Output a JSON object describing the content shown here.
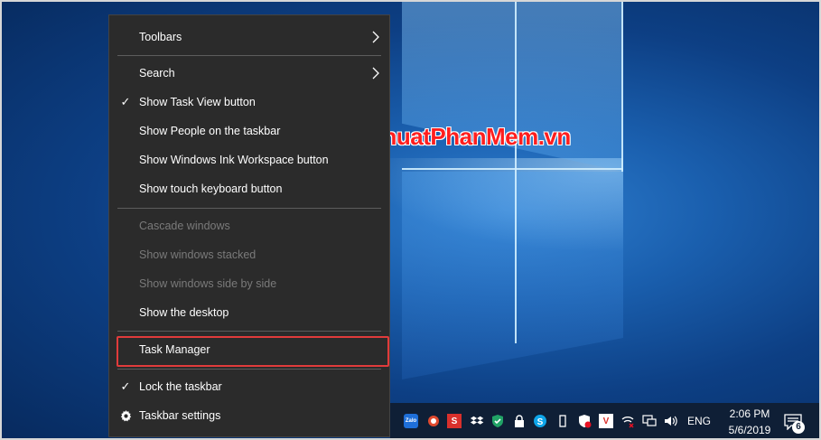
{
  "watermark": {
    "text": "ThuThuatPhanMem.vn"
  },
  "context_menu": {
    "items": {
      "toolbars": {
        "label": "Toolbars",
        "has_submenu": true
      },
      "search": {
        "label": "Search",
        "has_submenu": true
      },
      "show_task_view": {
        "label": "Show Task View button",
        "checked": true
      },
      "show_people": {
        "label": "Show People on the taskbar"
      },
      "show_ink": {
        "label": "Show Windows Ink Workspace button"
      },
      "show_touch_keyboard": {
        "label": "Show touch keyboard button"
      },
      "cascade": {
        "label": "Cascade windows",
        "disabled": true
      },
      "stacked": {
        "label": "Show windows stacked",
        "disabled": true
      },
      "side_by_side": {
        "label": "Show windows side by side",
        "disabled": true
      },
      "show_desktop": {
        "label": "Show the desktop"
      },
      "task_manager": {
        "label": "Task Manager",
        "highlighted": true
      },
      "lock_taskbar": {
        "label": "Lock the taskbar",
        "checked": true
      },
      "taskbar_settings": {
        "label": "Taskbar settings",
        "icon": "gear-icon"
      }
    },
    "highlight_color": "#e13b3b"
  },
  "taskbar": {
    "tray_icons": [
      {
        "name": "zalo-icon",
        "label": "Zalo"
      },
      {
        "name": "app-icon"
      },
      {
        "name": "s-app-icon",
        "label": "S"
      },
      {
        "name": "dropbox-icon"
      },
      {
        "name": "shield-check-icon"
      },
      {
        "name": "lock-icon"
      },
      {
        "name": "skype-icon"
      },
      {
        "name": "usb-icon"
      },
      {
        "name": "defender-icon"
      },
      {
        "name": "v-app-icon",
        "label": "V"
      },
      {
        "name": "wifi-off-icon"
      },
      {
        "name": "network-icon"
      },
      {
        "name": "volume-icon"
      }
    ],
    "language": "ENG",
    "time": "2:06 PM",
    "date": "5/6/2019",
    "notification_count": "6"
  },
  "colors": {
    "menu_bg": "#2b2b2b",
    "menu_text": "#ffffff",
    "menu_disabled_text": "#7a7a7a",
    "taskbar_bg": "#0f1f36",
    "watermark": "#ff1e1e"
  }
}
